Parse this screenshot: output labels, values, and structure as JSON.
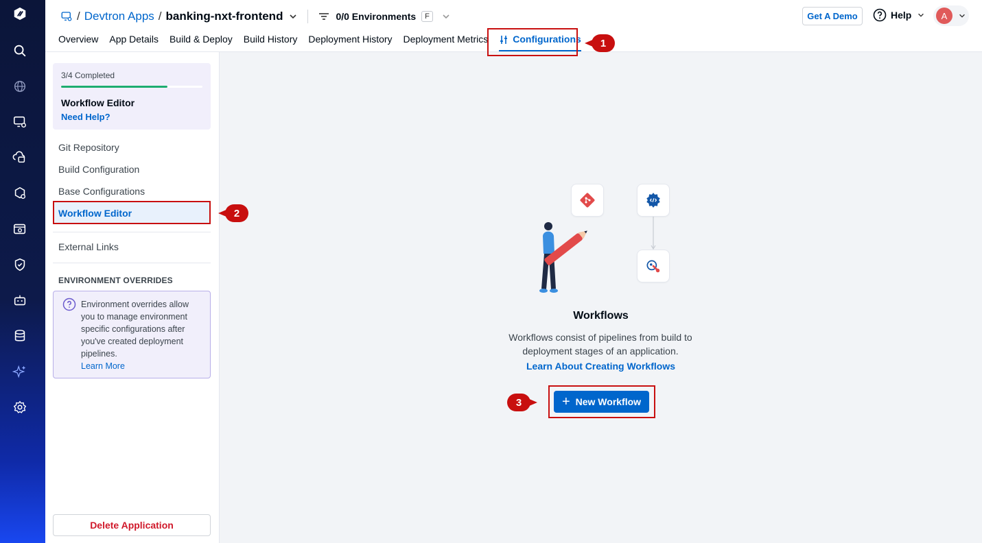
{
  "rail": {
    "icons": [
      "devtron-logo-icon",
      "search-icon",
      "globe-icon",
      "apps-icon",
      "jobs-icon",
      "charts-icon",
      "clusters-icon",
      "security-icon",
      "bot-icon",
      "database-icon",
      "sparkle-icon",
      "settings-icon"
    ]
  },
  "header": {
    "breadcrumb_sep": "/",
    "breadcrumb_parent": "Devtron Apps",
    "app_name": "banking-nxt-frontend",
    "env_filter": "0/0 Environments",
    "env_shortcut": "F",
    "get_demo": "Get A Demo",
    "help": "Help",
    "avatar_initial": "A"
  },
  "tabs": [
    {
      "label": "Overview"
    },
    {
      "label": "App Details"
    },
    {
      "label": "Build & Deploy"
    },
    {
      "label": "Build History"
    },
    {
      "label": "Deployment History"
    },
    {
      "label": "Deployment Metrics"
    },
    {
      "label": "Configurations",
      "active": true
    }
  ],
  "annotations": {
    "one": "1",
    "two": "2",
    "three": "3"
  },
  "sidebar": {
    "progress_label": "3/4 Completed",
    "progress_fraction": 0.75,
    "current_step": "Workflow Editor",
    "need_help": "Need Help?",
    "items": [
      {
        "label": "Git Repository"
      },
      {
        "label": "Build Configuration"
      },
      {
        "label": "Base Configurations"
      },
      {
        "label": "Workflow Editor",
        "active": true
      },
      {
        "label": "External Links"
      }
    ],
    "overrides_title": "ENVIRONMENT OVERRIDES",
    "overrides_text": "Environment overrides allow you to manage environment specific configurations after you've created deployment pipelines.",
    "overrides_link": "Learn More",
    "delete_label": "Delete Application"
  },
  "main": {
    "title": "Workflows",
    "subtitle": "Workflows consist of pipelines from build to deployment stages of an application.",
    "learn_link": "Learn About Creating Workflows",
    "new_workflow": "New Workflow"
  },
  "colors": {
    "accent": "#0066cc",
    "annotation": "#c80f0f",
    "progress": "#1dad70",
    "danger": "#d0182a"
  }
}
